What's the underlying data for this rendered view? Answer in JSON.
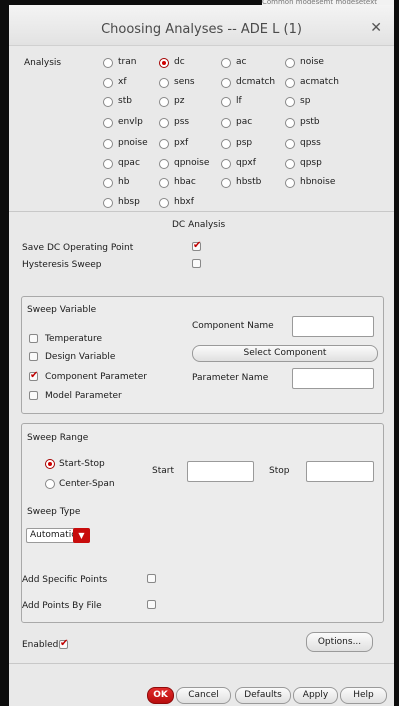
{
  "dialog": {
    "title": "Choosing Analyses -- ADE L (1)",
    "background_text": "Common modesemt modesetext"
  },
  "analysis_label": "Analysis",
  "analyses": [
    {
      "label": "tran",
      "selected": false
    },
    {
      "label": "dc",
      "selected": true
    },
    {
      "label": "ac",
      "selected": false
    },
    {
      "label": "noise",
      "selected": false
    },
    {
      "label": "xf",
      "selected": false
    },
    {
      "label": "sens",
      "selected": false
    },
    {
      "label": "dcmatch",
      "selected": false
    },
    {
      "label": "acmatch",
      "selected": false
    },
    {
      "label": "stb",
      "selected": false
    },
    {
      "label": "pz",
      "selected": false
    },
    {
      "label": "lf",
      "selected": false
    },
    {
      "label": "sp",
      "selected": false
    },
    {
      "label": "envlp",
      "selected": false
    },
    {
      "label": "pss",
      "selected": false
    },
    {
      "label": "pac",
      "selected": false
    },
    {
      "label": "pstb",
      "selected": false
    },
    {
      "label": "pnoise",
      "selected": false
    },
    {
      "label": "pxf",
      "selected": false
    },
    {
      "label": "psp",
      "selected": false
    },
    {
      "label": "qpss",
      "selected": false
    },
    {
      "label": "qpac",
      "selected": false
    },
    {
      "label": "qpnoise",
      "selected": false
    },
    {
      "label": "qpxf",
      "selected": false
    },
    {
      "label": "qpsp",
      "selected": false
    },
    {
      "label": "hb",
      "selected": false
    },
    {
      "label": "hbac",
      "selected": false
    },
    {
      "label": "hbstb",
      "selected": false
    },
    {
      "label": "hbnoise",
      "selected": false
    },
    {
      "label": "hbsp",
      "selected": false
    },
    {
      "label": "hbxf",
      "selected": false
    }
  ],
  "dc_section": {
    "heading": "DC Analysis",
    "save_dc_op_label": "Save DC Operating Point",
    "save_dc_op_checked": true,
    "hysteresis_label": "Hysteresis Sweep",
    "hysteresis_checked": false
  },
  "sweep_variable": {
    "title": "Sweep Variable",
    "options": [
      {
        "label": "Temperature",
        "checked": false
      },
      {
        "label": "Design Variable",
        "checked": false
      },
      {
        "label": "Component Parameter",
        "checked": true
      },
      {
        "label": "Model Parameter",
        "checked": false
      }
    ],
    "component_name_label": "Component Name",
    "component_name_value": "",
    "select_component_label": "Select Component",
    "parameter_name_label": "Parameter Name",
    "parameter_name_value": ""
  },
  "sweep_range": {
    "title": "Sweep Range",
    "start_stop_label": "Start-Stop",
    "start_stop_selected": true,
    "center_span_label": "Center-Span",
    "center_span_selected": false,
    "start_label": "Start",
    "start_value": "",
    "stop_label": "Stop",
    "stop_value": "",
    "sweep_type_label": "Sweep Type",
    "sweep_type_value": "Automatic",
    "add_specific_points_label": "Add Specific Points",
    "add_specific_points_checked": false,
    "add_points_by_file_label": "Add Points By File",
    "add_points_by_file_checked": false
  },
  "enabled_label": "Enabled",
  "enabled_checked": true,
  "options_button": "Options...",
  "buttons": {
    "ok": "OK",
    "cancel": "Cancel",
    "defaults": "Defaults",
    "apply": "Apply",
    "help": "Help"
  },
  "colors": {
    "accent": "#c80c0c",
    "panel": "#e9e9e9"
  }
}
